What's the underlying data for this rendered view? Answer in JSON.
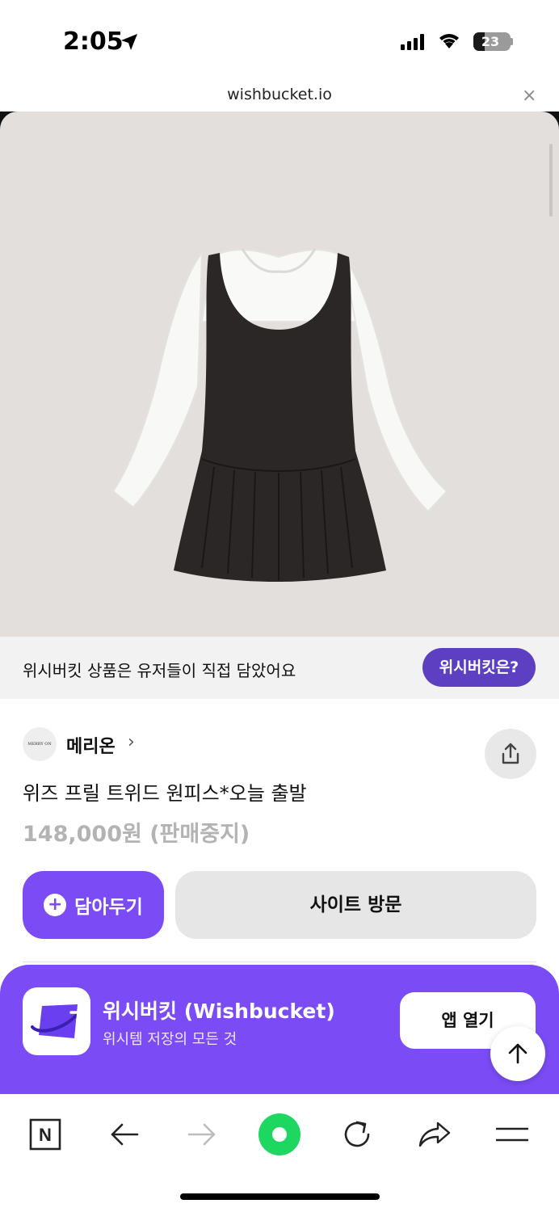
{
  "status_bar": {
    "time": "2:05",
    "battery": "23"
  },
  "browser": {
    "url": "wishbucket.io",
    "close": "×"
  },
  "notice": {
    "text": "위시버킷 상품은 유저들이 직접 담았어요",
    "button": "위시버킷은?"
  },
  "product": {
    "brand_logo_text": "MERRY ON",
    "brand": "메리온",
    "brand_chevron": "›",
    "title": "위즈 프릴 트위드 원피스*오늘 출발",
    "price": "148,000원 (판매중지)",
    "save_label": "담아두기",
    "save_plus": "+",
    "visit_label": "사이트 방문"
  },
  "app_banner": {
    "name": "위시버킷 (Wishbucket)",
    "subtitle": "위시템 저장의 모든 것",
    "open_label": "앱 열기"
  },
  "toolbar": {
    "naver_letter": "N"
  },
  "colors": {
    "accent": "#7b4cf5",
    "notice_button": "#5d3fc1",
    "image_bg": "#e3dfdd",
    "price_gray": "#b3b3b3",
    "green": "#1ed760"
  },
  "icons": [
    "location-arrow-icon",
    "signal-icon",
    "wifi-icon",
    "battery-icon",
    "close-icon",
    "chevron-right-icon",
    "share-icon",
    "plus-icon",
    "wishbucket-app-icon",
    "arrow-up-icon",
    "naver-icon",
    "back-arrow-icon",
    "forward-arrow-icon",
    "green-dot-icon",
    "reload-icon",
    "share-arrow-icon",
    "menu-icon"
  ]
}
